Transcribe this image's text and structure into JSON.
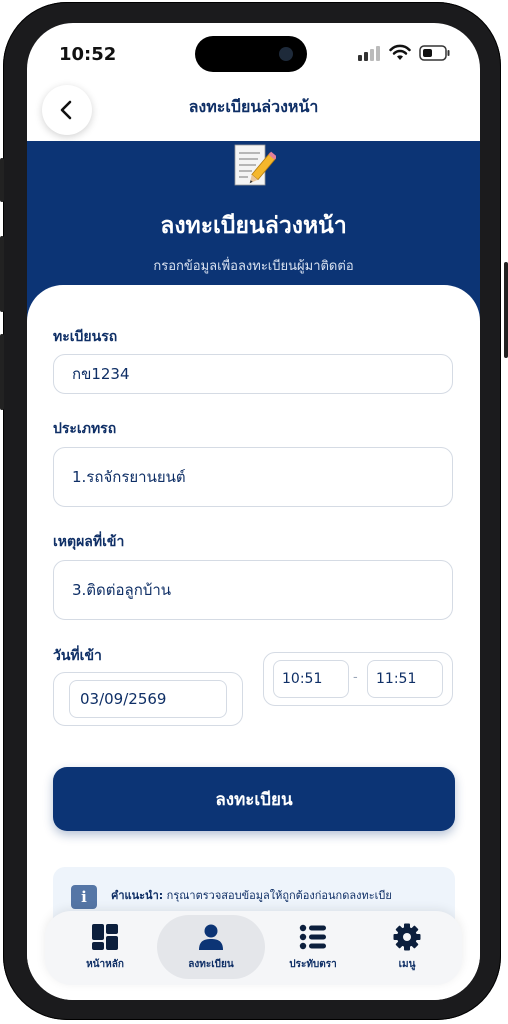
{
  "status_bar": {
    "time": "10:52"
  },
  "header": {
    "back_label": "back",
    "title": "ลงทะเบียนล่วงหน้า"
  },
  "hero": {
    "title": "ลงทะเบียนล่วงหน้า",
    "subtitle": "กรอกข้อมูลเพื่อลงทะเบียนผู้มาติดต่อ",
    "icon": "memo-icon"
  },
  "form": {
    "plate": {
      "label": "ทะเบียนรถ",
      "value": "กข1234"
    },
    "vehicle_type": {
      "label": "ประเภทรถ",
      "value": "1.รถจักรยานยนต์"
    },
    "reason": {
      "label": "เหตุผลที่เข้า",
      "value": "3.ติดต่อลูกบ้าน"
    },
    "date": {
      "label": "วันที่เข้า",
      "value": "03/09/2569"
    },
    "time_from": "10:51",
    "time_separator": "-",
    "time_to": "11:51",
    "submit_label": "ลงทะเบียน"
  },
  "hint": {
    "title": "คำแนะนำ:",
    "text": "กรุณาตรวจสอบข้อมูลให้ถูกต้องก่อนกดลงทะเบีย",
    "icon_letter": "i"
  },
  "nav": {
    "items": [
      {
        "label": "หน้าหลัก",
        "icon": "dashboard-icon",
        "active": false
      },
      {
        "label": "ลงทะเบียน",
        "icon": "user-icon",
        "active": true
      },
      {
        "label": "ประทับตรา",
        "icon": "list-icon",
        "active": false
      },
      {
        "label": "เมนู",
        "icon": "gear-icon",
        "active": false
      }
    ]
  },
  "colors": {
    "primary": "#0c3475",
    "text": "#0f2f66",
    "hint_bg": "#eef4fb"
  }
}
